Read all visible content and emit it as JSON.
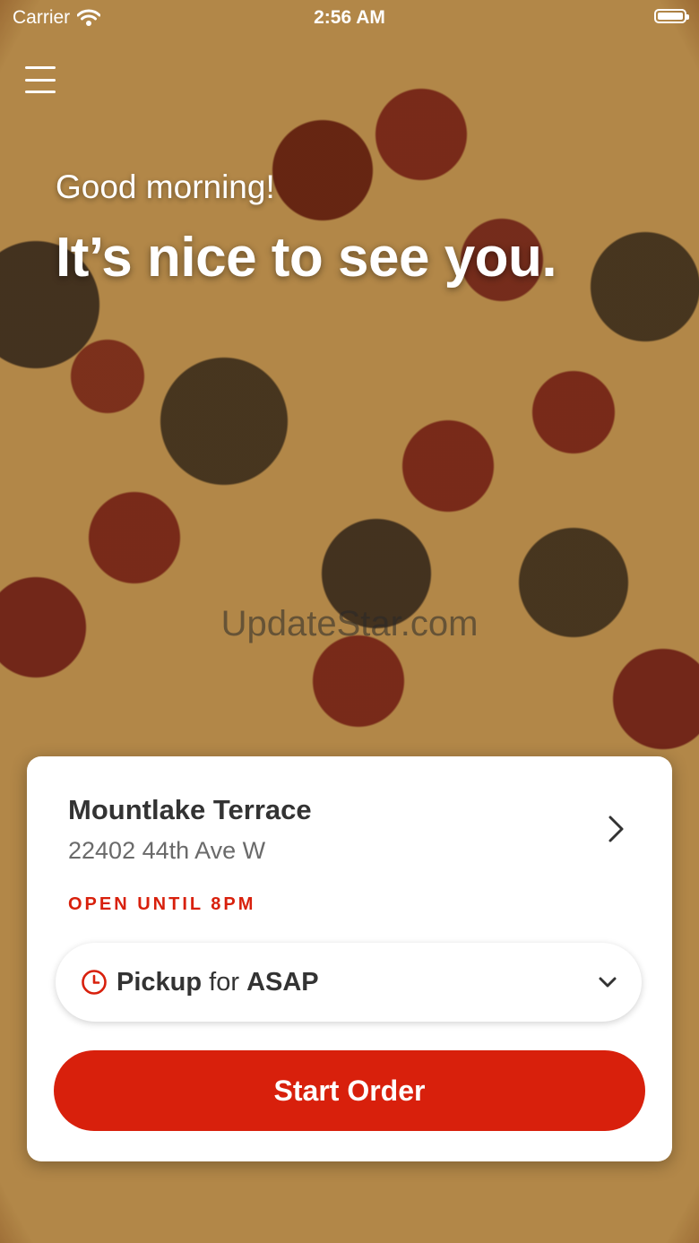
{
  "status_bar": {
    "carrier": "Carrier",
    "time": "2:56 AM",
    "wifi_icon": "wifi-icon",
    "battery_icon": "battery-full-icon"
  },
  "header": {
    "menu_icon": "hamburger-menu-icon",
    "greeting": "Good morning!",
    "headline": "It’s nice to see you."
  },
  "watermark": "UpdateStar.com",
  "store": {
    "name": "Mountlake Terrace",
    "address": "22402 44th Ave W",
    "status": "OPEN UNTIL 8PM",
    "status_color": "#d8200c"
  },
  "order": {
    "mode": "Pickup",
    "connector": "for",
    "time": "ASAP",
    "start_label": "Start Order",
    "accent_color": "#d8200c"
  }
}
